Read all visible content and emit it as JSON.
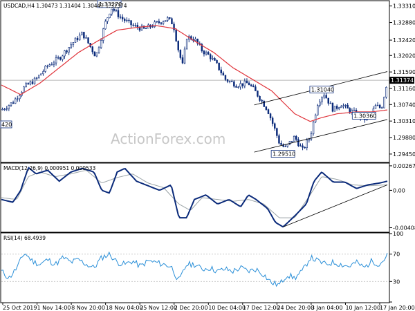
{
  "chart_data": [
    {
      "type": "candlestick",
      "title": "USDCAD,H4  1.30473  1.31404  1.30447  1.31374",
      "timeframe": "H4",
      "symbol": "USDCAD",
      "ohlc_label": "1.30473 1.31404 1.30447 1.31374",
      "current_price": 1.31374,
      "current_price_label": "1.31374",
      "ylim": [
        1.2925,
        1.3343
      ],
      "y_ticks": [
        "1.33310",
        "1.32880",
        "1.32420",
        "1.32020",
        "1.31590",
        "1.31160",
        "1.30740",
        "1.30310",
        "1.29880",
        "1.29450"
      ],
      "y_tick_values": [
        1.3331,
        1.3288,
        1.3242,
        1.3202,
        1.3159,
        1.3116,
        1.3074,
        1.3031,
        1.2988,
        1.2945
      ],
      "left_edge_label": "420",
      "moving_average_color": "#e0353c",
      "candle_color": "#0a2a7a",
      "annotations": [
        {
          "text": "1.33270",
          "price": 1.3327
        },
        {
          "text": "1.31040",
          "price": 1.3104
        },
        {
          "text": "1.30360",
          "price": 1.3036
        },
        {
          "text": "1.29510",
          "price": 1.2951
        }
      ],
      "channel": {
        "upper": [
          [
            0.655,
            1.3073
          ],
          [
            1.0,
            1.316
          ]
        ],
        "lower": [
          [
            0.655,
            1.295
          ],
          [
            1.0,
            1.3035
          ]
        ]
      },
      "path_keypoints": [
        [
          0.0,
          1.306
        ],
        [
          0.03,
          1.308
        ],
        [
          0.06,
          1.312
        ],
        [
          0.09,
          1.314
        ],
        [
          0.12,
          1.3175
        ],
        [
          0.15,
          1.3195
        ],
        [
          0.18,
          1.323
        ],
        [
          0.21,
          1.326
        ],
        [
          0.245,
          1.32
        ],
        [
          0.27,
          1.329
        ],
        [
          0.285,
          1.3327
        ],
        [
          0.31,
          1.33
        ],
        [
          0.34,
          1.328
        ],
        [
          0.37,
          1.327
        ],
        [
          0.4,
          1.3285
        ],
        [
          0.43,
          1.3298
        ],
        [
          0.445,
          1.3285
        ],
        [
          0.46,
          1.321
        ],
        [
          0.47,
          1.3175
        ],
        [
          0.48,
          1.325
        ],
        [
          0.5,
          1.3245
        ],
        [
          0.52,
          1.3215
        ],
        [
          0.54,
          1.32
        ],
        [
          0.56,
          1.3175
        ],
        [
          0.58,
          1.314
        ],
        [
          0.61,
          1.3125
        ],
        [
          0.64,
          1.313
        ],
        [
          0.66,
          1.3105
        ],
        [
          0.69,
          1.306
        ],
        [
          0.71,
          1.3005
        ],
        [
          0.72,
          1.2975
        ],
        [
          0.735,
          1.296
        ],
        [
          0.76,
          1.299
        ],
        [
          0.78,
          1.2955
        ],
        [
          0.8,
          1.299
        ],
        [
          0.82,
          1.308
        ],
        [
          0.835,
          1.3104
        ],
        [
          0.86,
          1.306
        ],
        [
          0.88,
          1.3075
        ],
        [
          0.9,
          1.306
        ],
        [
          0.92,
          1.305
        ],
        [
          0.94,
          1.3036
        ],
        [
          0.955,
          1.3045
        ],
        [
          0.97,
          1.307
        ],
        [
          0.985,
          1.3065
        ],
        [
          1.0,
          1.3137
        ]
      ],
      "ma_keypoints": [
        [
          0.0,
          1.3125
        ],
        [
          0.05,
          1.31
        ],
        [
          0.1,
          1.313
        ],
        [
          0.15,
          1.317
        ],
        [
          0.2,
          1.321
        ],
        [
          0.25,
          1.324
        ],
        [
          0.3,
          1.3268
        ],
        [
          0.35,
          1.3275
        ],
        [
          0.4,
          1.328
        ],
        [
          0.45,
          1.3272
        ],
        [
          0.5,
          1.324
        ],
        [
          0.55,
          1.321
        ],
        [
          0.6,
          1.317
        ],
        [
          0.65,
          1.314
        ],
        [
          0.7,
          1.311
        ],
        [
          0.73,
          1.308
        ],
        [
          0.76,
          1.305
        ],
        [
          0.8,
          1.303
        ],
        [
          0.83,
          1.304
        ],
        [
          0.87,
          1.305
        ],
        [
          0.92,
          1.3055
        ],
        [
          0.96,
          1.3055
        ],
        [
          1.0,
          1.306
        ]
      ]
    },
    {
      "type": "line",
      "title": "MACD(12,26,9) 0.000951 0.000533",
      "indicator": "MACD(12,26,9)",
      "values_label": "0.000951 0.000533",
      "ylim": [
        -0.0045,
        0.0029
      ],
      "y_ticks": [
        "0.002679",
        "0.00",
        "-0.004086"
      ],
      "y_tick_values": [
        0.002679,
        0.0,
        -0.004086
      ],
      "series": [
        {
          "name": "MACD",
          "color": "#0a2a7a"
        },
        {
          "name": "Signal",
          "color": "#9aa3a6"
        }
      ],
      "macd_keypoints": [
        [
          0.0,
          -0.001
        ],
        [
          0.03,
          -0.0013
        ],
        [
          0.05,
          0.0
        ],
        [
          0.07,
          0.0025
        ],
        [
          0.09,
          0.0018
        ],
        [
          0.12,
          0.0022
        ],
        [
          0.15,
          0.001
        ],
        [
          0.18,
          0.002
        ],
        [
          0.21,
          0.0024
        ],
        [
          0.24,
          0.002
        ],
        [
          0.26,
          0.0
        ],
        [
          0.28,
          -0.0003
        ],
        [
          0.3,
          0.002
        ],
        [
          0.32,
          0.0024
        ],
        [
          0.35,
          0.001
        ],
        [
          0.38,
          0.0005
        ],
        [
          0.41,
          0.0
        ],
        [
          0.44,
          0.0006
        ],
        [
          0.46,
          -0.003
        ],
        [
          0.48,
          -0.003
        ],
        [
          0.5,
          -0.001
        ],
        [
          0.53,
          -0.0005
        ],
        [
          0.56,
          -0.0015
        ],
        [
          0.59,
          -0.001
        ],
        [
          0.62,
          -0.0018
        ],
        [
          0.64,
          -0.0005
        ],
        [
          0.66,
          -0.001
        ],
        [
          0.69,
          -0.002
        ],
        [
          0.71,
          -0.0035
        ],
        [
          0.73,
          -0.004
        ],
        [
          0.76,
          -0.0028
        ],
        [
          0.79,
          -0.0015
        ],
        [
          0.81,
          0.001
        ],
        [
          0.83,
          0.002
        ],
        [
          0.86,
          0.0009
        ],
        [
          0.89,
          0.0009
        ],
        [
          0.92,
          0.0002
        ],
        [
          0.95,
          0.0006
        ],
        [
          0.98,
          0.0008
        ],
        [
          1.0,
          0.001
        ]
      ],
      "signal_keypoints": [
        [
          0.0,
          -0.0008
        ],
        [
          0.04,
          -0.001
        ],
        [
          0.07,
          0.0015
        ],
        [
          0.1,
          0.002
        ],
        [
          0.14,
          0.0015
        ],
        [
          0.18,
          0.0018
        ],
        [
          0.22,
          0.0022
        ],
        [
          0.26,
          0.0008
        ],
        [
          0.3,
          0.0014
        ],
        [
          0.34,
          0.0018
        ],
        [
          0.38,
          0.0008
        ],
        [
          0.42,
          0.0003
        ],
        [
          0.46,
          -0.0015
        ],
        [
          0.49,
          -0.0022
        ],
        [
          0.52,
          -0.0008
        ],
        [
          0.56,
          -0.001
        ],
        [
          0.6,
          -0.0012
        ],
        [
          0.64,
          -0.001
        ],
        [
          0.68,
          -0.0015
        ],
        [
          0.72,
          -0.003
        ],
        [
          0.76,
          -0.003
        ],
        [
          0.8,
          -0.0005
        ],
        [
          0.83,
          0.0015
        ],
        [
          0.87,
          0.0012
        ],
        [
          0.91,
          0.0006
        ],
        [
          0.95,
          0.0005
        ],
        [
          1.0,
          0.0006
        ]
      ],
      "trendline": [
        [
          0.73,
          -0.004
        ],
        [
          1.0,
          0.0006
        ]
      ]
    },
    {
      "type": "line",
      "title": "RSI(14) 68.4939",
      "indicator": "RSI(14)",
      "values_label": "68.4939",
      "ylim": [
        0,
        100
      ],
      "y_ticks": [
        "100",
        "70",
        "30",
        "0"
      ],
      "y_tick_values": [
        100,
        70,
        30,
        0
      ],
      "series": [
        {
          "name": "RSI",
          "color": "#2a8fd8"
        }
      ],
      "rsi_keypoints": [
        [
          0.0,
          45
        ],
        [
          0.02,
          35
        ],
        [
          0.04,
          50
        ],
        [
          0.06,
          72
        ],
        [
          0.08,
          60
        ],
        [
          0.1,
          55
        ],
        [
          0.12,
          62
        ],
        [
          0.14,
          55
        ],
        [
          0.16,
          65
        ],
        [
          0.18,
          58
        ],
        [
          0.2,
          62
        ],
        [
          0.22,
          55
        ],
        [
          0.24,
          50
        ],
        [
          0.26,
          65
        ],
        [
          0.28,
          70
        ],
        [
          0.3,
          58
        ],
        [
          0.32,
          55
        ],
        [
          0.34,
          60
        ],
        [
          0.36,
          52
        ],
        [
          0.38,
          60
        ],
        [
          0.4,
          58
        ],
        [
          0.42,
          55
        ],
        [
          0.44,
          52
        ],
        [
          0.46,
          30
        ],
        [
          0.48,
          55
        ],
        [
          0.5,
          55
        ],
        [
          0.52,
          48
        ],
        [
          0.54,
          50
        ],
        [
          0.56,
          45
        ],
        [
          0.58,
          48
        ],
        [
          0.6,
          45
        ],
        [
          0.62,
          50
        ],
        [
          0.64,
          45
        ],
        [
          0.66,
          48
        ],
        [
          0.68,
          40
        ],
        [
          0.7,
          28
        ],
        [
          0.72,
          25
        ],
        [
          0.74,
          40
        ],
        [
          0.76,
          35
        ],
        [
          0.78,
          45
        ],
        [
          0.8,
          65
        ],
        [
          0.82,
          60
        ],
        [
          0.84,
          55
        ],
        [
          0.86,
          58
        ],
        [
          0.88,
          55
        ],
        [
          0.9,
          52
        ],
        [
          0.92,
          58
        ],
        [
          0.94,
          50
        ],
        [
          0.96,
          60
        ],
        [
          0.98,
          55
        ],
        [
          1.0,
          68
        ]
      ]
    }
  ],
  "x_axis_labels": [
    "25 Oct 2019",
    "1 Nov 14:00",
    "8 Nov 20:00",
    "18 Nov 04:00",
    "25 Nov 12:00",
    "2 Dec 20:00",
    "10 Dec 04:00",
    "17 Dec 12:00",
    "24 Dec 20:00",
    "3 Jan 04:00",
    "10 Jan 12:00",
    "17 Jan 20:00"
  ],
  "watermark": "ActionForex.com"
}
